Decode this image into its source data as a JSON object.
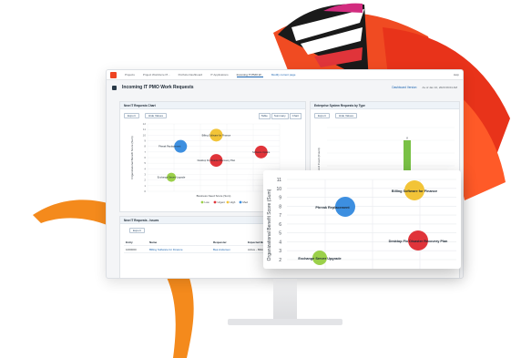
{
  "nav": {
    "tabs": [
      "Projects",
      "Project Workforce Pl...",
      "Portfolio Dashboard",
      "IT Applications",
      "Incoming IT PMO W..."
    ],
    "active_tab": "Incoming IT PMO W...",
    "link": "Modify current page",
    "right_label": "Help"
  },
  "page": {
    "title": "Incoming IT PMO Work Requests",
    "dashboard_version": "Dashboard Version",
    "as_of": "As of Jan 10, 2020 09:04 AM"
  },
  "panel_left": {
    "title": "New IT Requests Chart",
    "buttons": [
      "Export",
      "Hide Values"
    ],
    "views": [
      "Table",
      "Summary",
      "Chart"
    ],
    "ylabel": "Organizational Benefit Score (Sum)",
    "xlabel": "Business Need Score (Sum)",
    "legend": [
      "Low",
      "Urgent",
      "High",
      "Med"
    ]
  },
  "panel_right": {
    "title": "Enterprise System Requests by Type",
    "buttons": [
      "Export",
      "Hide Values"
    ],
    "ylabel": "Record Count (Count)"
  },
  "panel_bottom": {
    "title": "New IT Requests - Issues",
    "button": "Export",
    "columns": [
      "Entry",
      "Name",
      "Requester",
      "Expected Business Value"
    ],
    "rows": [
      {
        "entry": "1000000",
        "name": "Billing Software for Finance",
        "requester": "Bea Andersen",
        "value": "Active - Billing"
      }
    ]
  },
  "zoom_chart": {
    "ylabel": "Organizational Benefit Score (Sum)",
    "yticks": [
      "11",
      "10",
      "9",
      "8",
      "7",
      "6",
      "5",
      "4",
      "3",
      "2"
    ]
  },
  "chart_data": {
    "type": "scatter",
    "title": "New IT Requests Chart",
    "xlabel": "Business Need Score (Sum)",
    "ylabel": "Organizational Benefit Score (Sum)",
    "ylim": [
      0,
      12
    ],
    "xlim": [
      0,
      10
    ],
    "grid": true,
    "legend_position": "bottom",
    "colors": {
      "Low": "#9bd04a",
      "Urgent": "#e0343a",
      "High": "#f2c438",
      "Med": "#3d8fe0"
    },
    "points": [
      {
        "label": "Phreak Replacement",
        "x": 2.5,
        "y": 8,
        "priority": "Med"
      },
      {
        "label": "Billing Software for Finance",
        "x": 5.2,
        "y": 10,
        "priority": "High"
      },
      {
        "label": "Desktop Fix Disaster Recovery Plan",
        "x": 5.2,
        "y": 5.5,
        "priority": "Urgent"
      },
      {
        "label": "Exchange Server Upgrade",
        "x": 1.8,
        "y": 2.5,
        "priority": "Low"
      },
      {
        "label": "Software Update",
        "x": 8.6,
        "y": 7,
        "priority": "Urgent"
      }
    ]
  },
  "bar_data": {
    "type": "bar",
    "title": "Enterprise System Requests by Type",
    "values": [
      1,
      8
    ],
    "colors": [
      "#f2c438",
      "#79c145"
    ]
  }
}
